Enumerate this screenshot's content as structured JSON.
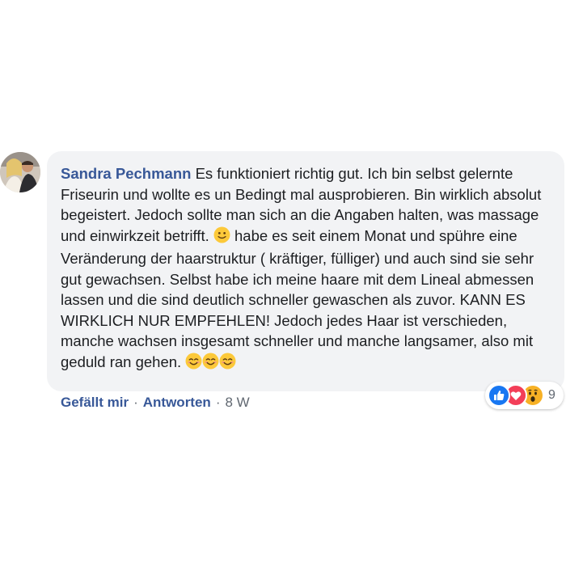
{
  "comment": {
    "author": "Sandra Pechmann",
    "text_parts": [
      "Es funktioniert richtig gut. Ich bin selbst gelernte Friseurin und wollte es un Bedingt mal ausprobieren. Bin wirklich absolut begeistert. Jedoch sollte man sich an die Angaben halten, was massage und einwirkzeit betrifft.",
      "habe es seit einem Monat und spühre eine Veränderung der haarstruktur ( kräftiger, fülliger) und auch sind sie sehr gut gewachsen. Selbst habe ich meine haare mit dem Lineal abmessen lassen und die sind deutlich schneller gewaschen als zuvor. KANN ES WIRKLICH NUR EMPFEHLEN! Jedoch jedes Haar ist verschieden, manche wachsen insgesamt schneller und manche langsamer, also mit geduld ran gehen."
    ],
    "emojis": [
      "slightly-smiling-face",
      "smiling-face-with-smiling-eyes",
      "smiling-face-with-smiling-eyes",
      "smiling-face-with-smiling-eyes"
    ]
  },
  "actions": {
    "like_label": "Gefällt mir",
    "separator": "·",
    "reply_label": "Antworten",
    "timestamp": "8 W"
  },
  "reactions": {
    "types": [
      "like",
      "love",
      "wow"
    ],
    "count": "9",
    "colors": {
      "like": "#1877f2",
      "love": "#f33e58",
      "wow": "#f7b125"
    }
  },
  "colors": {
    "author": "#385898",
    "bubble": "#f2f3f5",
    "meta": "#606770"
  }
}
